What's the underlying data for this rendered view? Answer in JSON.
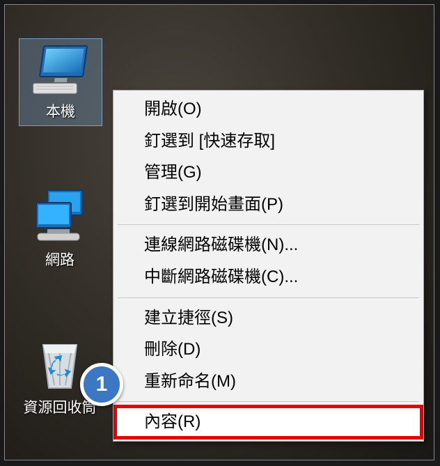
{
  "desktop": {
    "icons": {
      "this_pc": {
        "label": "本機",
        "selected": true
      },
      "network": {
        "label": "網路",
        "selected": false
      },
      "recycle": {
        "label": "資源回收筒",
        "selected": false
      }
    }
  },
  "context_menu": {
    "items": [
      {
        "label": "開啟(O)"
      },
      {
        "label": "釘選到 [快速存取]"
      },
      {
        "label": "管理(G)"
      },
      {
        "label": "釘選到開始畫面(P)"
      },
      {
        "type": "separator"
      },
      {
        "label": "連線網路磁碟機(N)..."
      },
      {
        "label": "中斷網路磁碟機(C)..."
      },
      {
        "type": "separator"
      },
      {
        "label": "建立捷徑(S)"
      },
      {
        "label": "刪除(D)"
      },
      {
        "label": "重新命名(M)"
      },
      {
        "type": "separator"
      },
      {
        "label": "內容(R)",
        "highlight": true
      }
    ]
  },
  "annotations": {
    "step1": "1"
  }
}
